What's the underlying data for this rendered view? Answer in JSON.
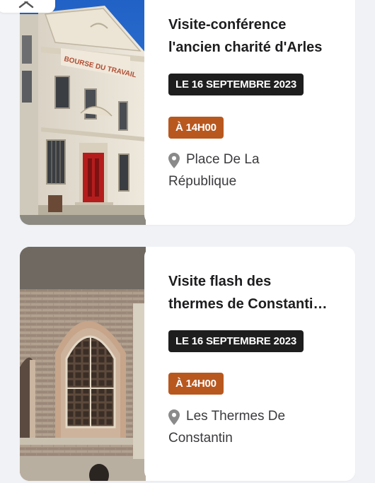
{
  "events": [
    {
      "title_line1": "Visite-conférence",
      "title_line2": "l'ancien charité d'Arles",
      "date": "LE 16 SEPTEMBRE 2023",
      "time": "À 14H00",
      "location_line1": "Place De La",
      "location_line2": "République",
      "image_sign": "BOURSE DU TRAVAIL"
    },
    {
      "title_line1": "Visite flash des",
      "title_line2": "thermes de Constanti…",
      "date": "LE 16 SEPTEMBRE 2023",
      "time": "À 14H00",
      "location_line1": "Les Thermes De",
      "location_line2": "Constantin"
    }
  ],
  "colors": {
    "date_badge": "#1e1e1e",
    "time_badge": "#b8581f",
    "page_background": "#f1f2f6",
    "pin": "#8a8a8a"
  },
  "icons": {
    "close": "close-icon",
    "pin": "map-pin-icon"
  }
}
